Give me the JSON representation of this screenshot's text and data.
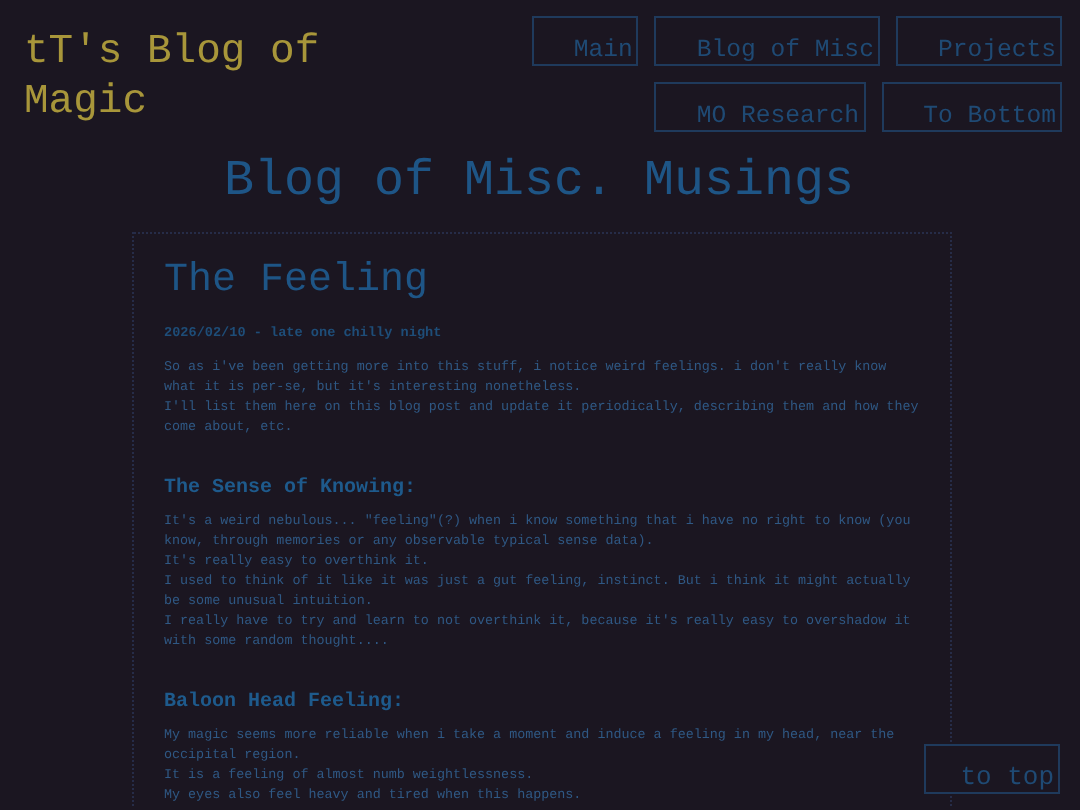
{
  "site_title": "tT's Blog of Magic",
  "nav": [
    {
      "label": "Main"
    },
    {
      "label": "Blog of Misc"
    },
    {
      "label": "Projects"
    },
    {
      "label": "MO Research"
    },
    {
      "label": "To Bottom"
    }
  ],
  "page_heading": "Blog of Misc. Musings",
  "post": {
    "title": "The Feeling",
    "date": "2026/02/10 - late one chilly night",
    "intro": [
      "So as i've been getting more into this stuff, i notice weird feelings. i don't really know what it is per-se, but it's interesting nonetheless.",
      "I'll list them here on this blog post and update it periodically, describing them and how they come about, etc."
    ],
    "sections": [
      {
        "heading": "The Sense of Knowing:",
        "lines": [
          "It's a weird nebulous... \"feeling\"(?) when i know something that i have no right to know (you know, through memories or any observable typical sense data).",
          "It's really easy to overthink it.",
          "I used to think of it like it was just a gut feeling, instinct. But i think it might actually be some unusual intuition.",
          "I really have to try and learn to not overthink it, because it's really easy to overshadow it with some random thought...."
        ]
      },
      {
        "heading": "Baloon Head Feeling:",
        "lines": [
          "My magic seems more reliable when i take a moment and induce a feeling in my head, near the occipital region.",
          "It is a feeling of almost numb weightlessness.",
          "My eyes also feel heavy and tired when this happens."
        ]
      }
    ]
  },
  "to_top": "to top"
}
